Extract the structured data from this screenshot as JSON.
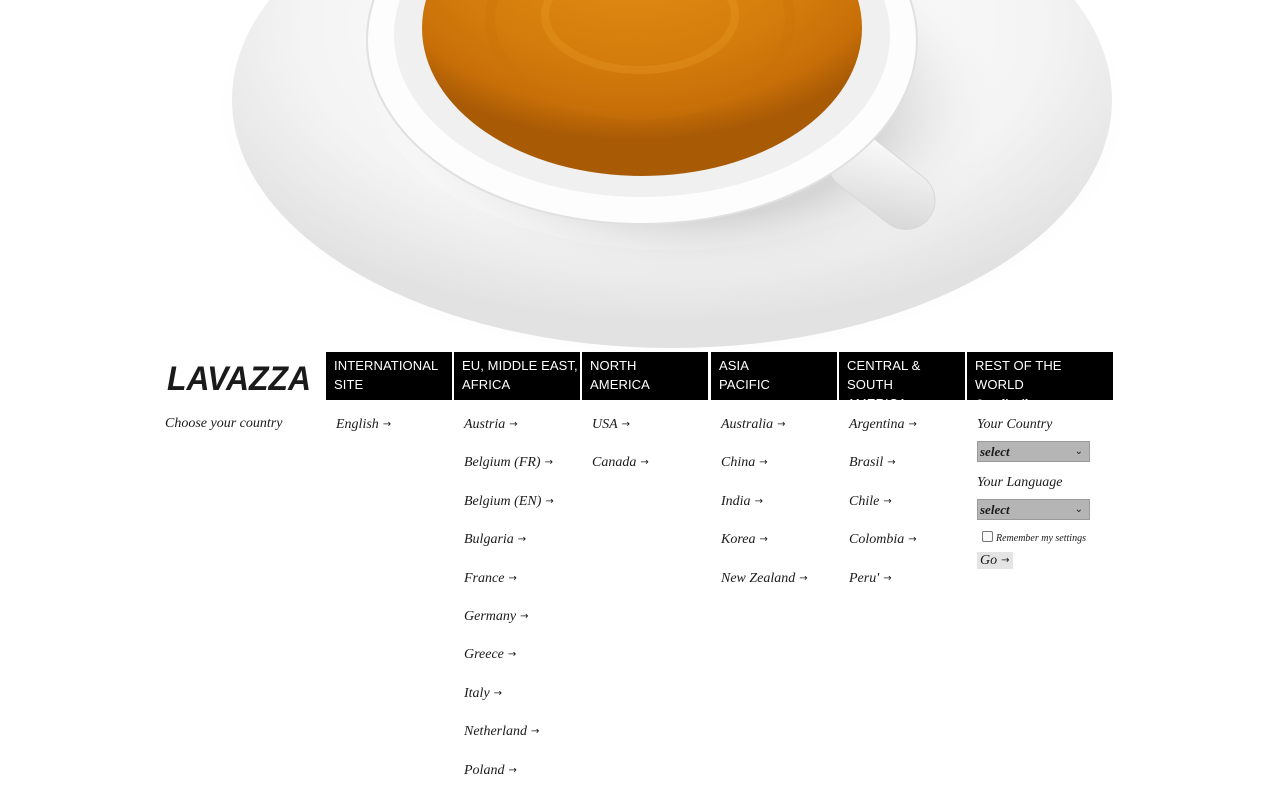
{
  "brand": {
    "logo_text": "LAVAZZA",
    "colors": {
      "header_bg": "#000000",
      "header_text": "#ffffff",
      "coffee": "#d9820f",
      "select_bg": "#b5b5b5"
    }
  },
  "choose_label": "Choose your country",
  "regions": [
    {
      "line1": "INTERNATIONAL",
      "line2": "SITE"
    },
    {
      "line1": "EU, MIDDLE EAST,",
      "line2": "AFRICA"
    },
    {
      "line1": "NORTH",
      "line2": "AMERICA"
    },
    {
      "line1": "ASIA",
      "line2": "PACIFIC"
    },
    {
      "line1": "CENTRAL & SOUTH",
      "line2": "AMERICA"
    },
    {
      "line1": "REST OF THE WORLD",
      "line2": "Our distributors"
    }
  ],
  "columns": {
    "international": [
      "English"
    ],
    "emea": [
      "Austria",
      "Belgium (FR)",
      "Belgium (EN)",
      "Bulgaria",
      "France",
      "Germany",
      "Greece",
      "Italy",
      "Netherland",
      "Poland"
    ],
    "north_america": [
      "USA",
      "Canada"
    ],
    "asia_pacific": [
      "Australia",
      "China",
      "India",
      "Korea",
      "New Zealand"
    ],
    "latam": [
      "Argentina",
      "Brasil",
      "Chile",
      "Colombia",
      "Peru'"
    ]
  },
  "arrow_glyph": "→",
  "distributor_form": {
    "country_label": "Your Country",
    "country_value": "select",
    "language_label": "Your Language",
    "language_value": "select",
    "remember_label": "Remember my settings",
    "remember_checked": false,
    "go_label": "Go",
    "go_arrow": "→"
  }
}
